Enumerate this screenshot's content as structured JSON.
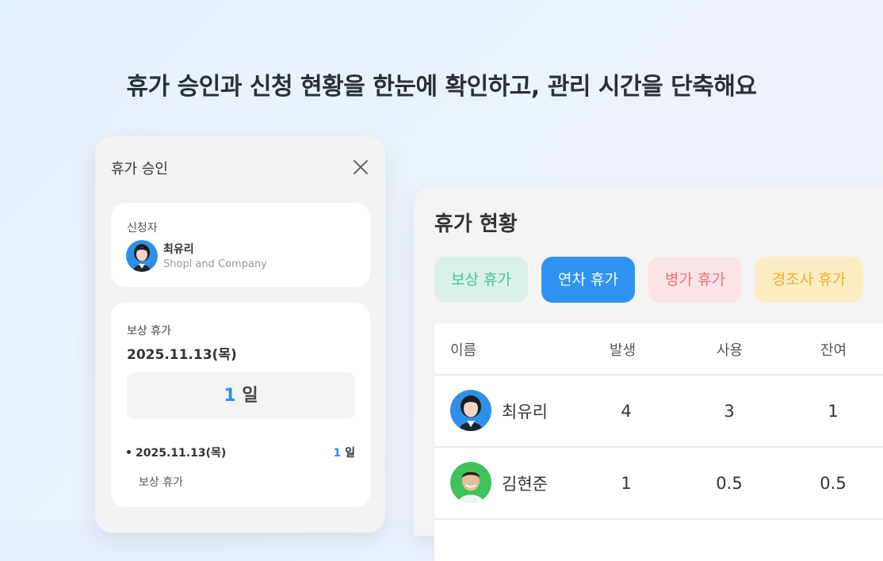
{
  "headline": "휴가 승인과 신청 현황을 한눈에 확인하고, 관리 시간을 단축해요",
  "approval": {
    "title": "휴가 승인",
    "applicant_label": "신청자",
    "applicant_name": "최유리",
    "applicant_company": "Shopl and Company",
    "leave_type": "보상 휴가",
    "date": "2025.11.13(목)",
    "days_number": "1",
    "days_unit": "일",
    "items": [
      {
        "date": "2025.11.13(목)",
        "days_number": "1",
        "days_unit": "일",
        "type": "보상 휴가"
      }
    ]
  },
  "status": {
    "title": "휴가 현황",
    "chips": [
      "보상 휴가",
      "연차 휴가",
      "병가 휴가",
      "경조사 휴가"
    ],
    "chip_colors": {
      "comp": "#d9f2e9",
      "annual": "#2e93f3",
      "sick": "#fbe4e6",
      "family": "#fcecc2"
    },
    "columns": [
      "이름",
      "발생",
      "사용",
      "잔여"
    ],
    "rows": [
      {
        "name": "최유리",
        "issued": "4",
        "used": "3",
        "remaining": "1"
      },
      {
        "name": "김현준",
        "issued": "1",
        "used": "0.5",
        "remaining": "0.5"
      }
    ]
  },
  "accent_color": "#2b8ef0"
}
